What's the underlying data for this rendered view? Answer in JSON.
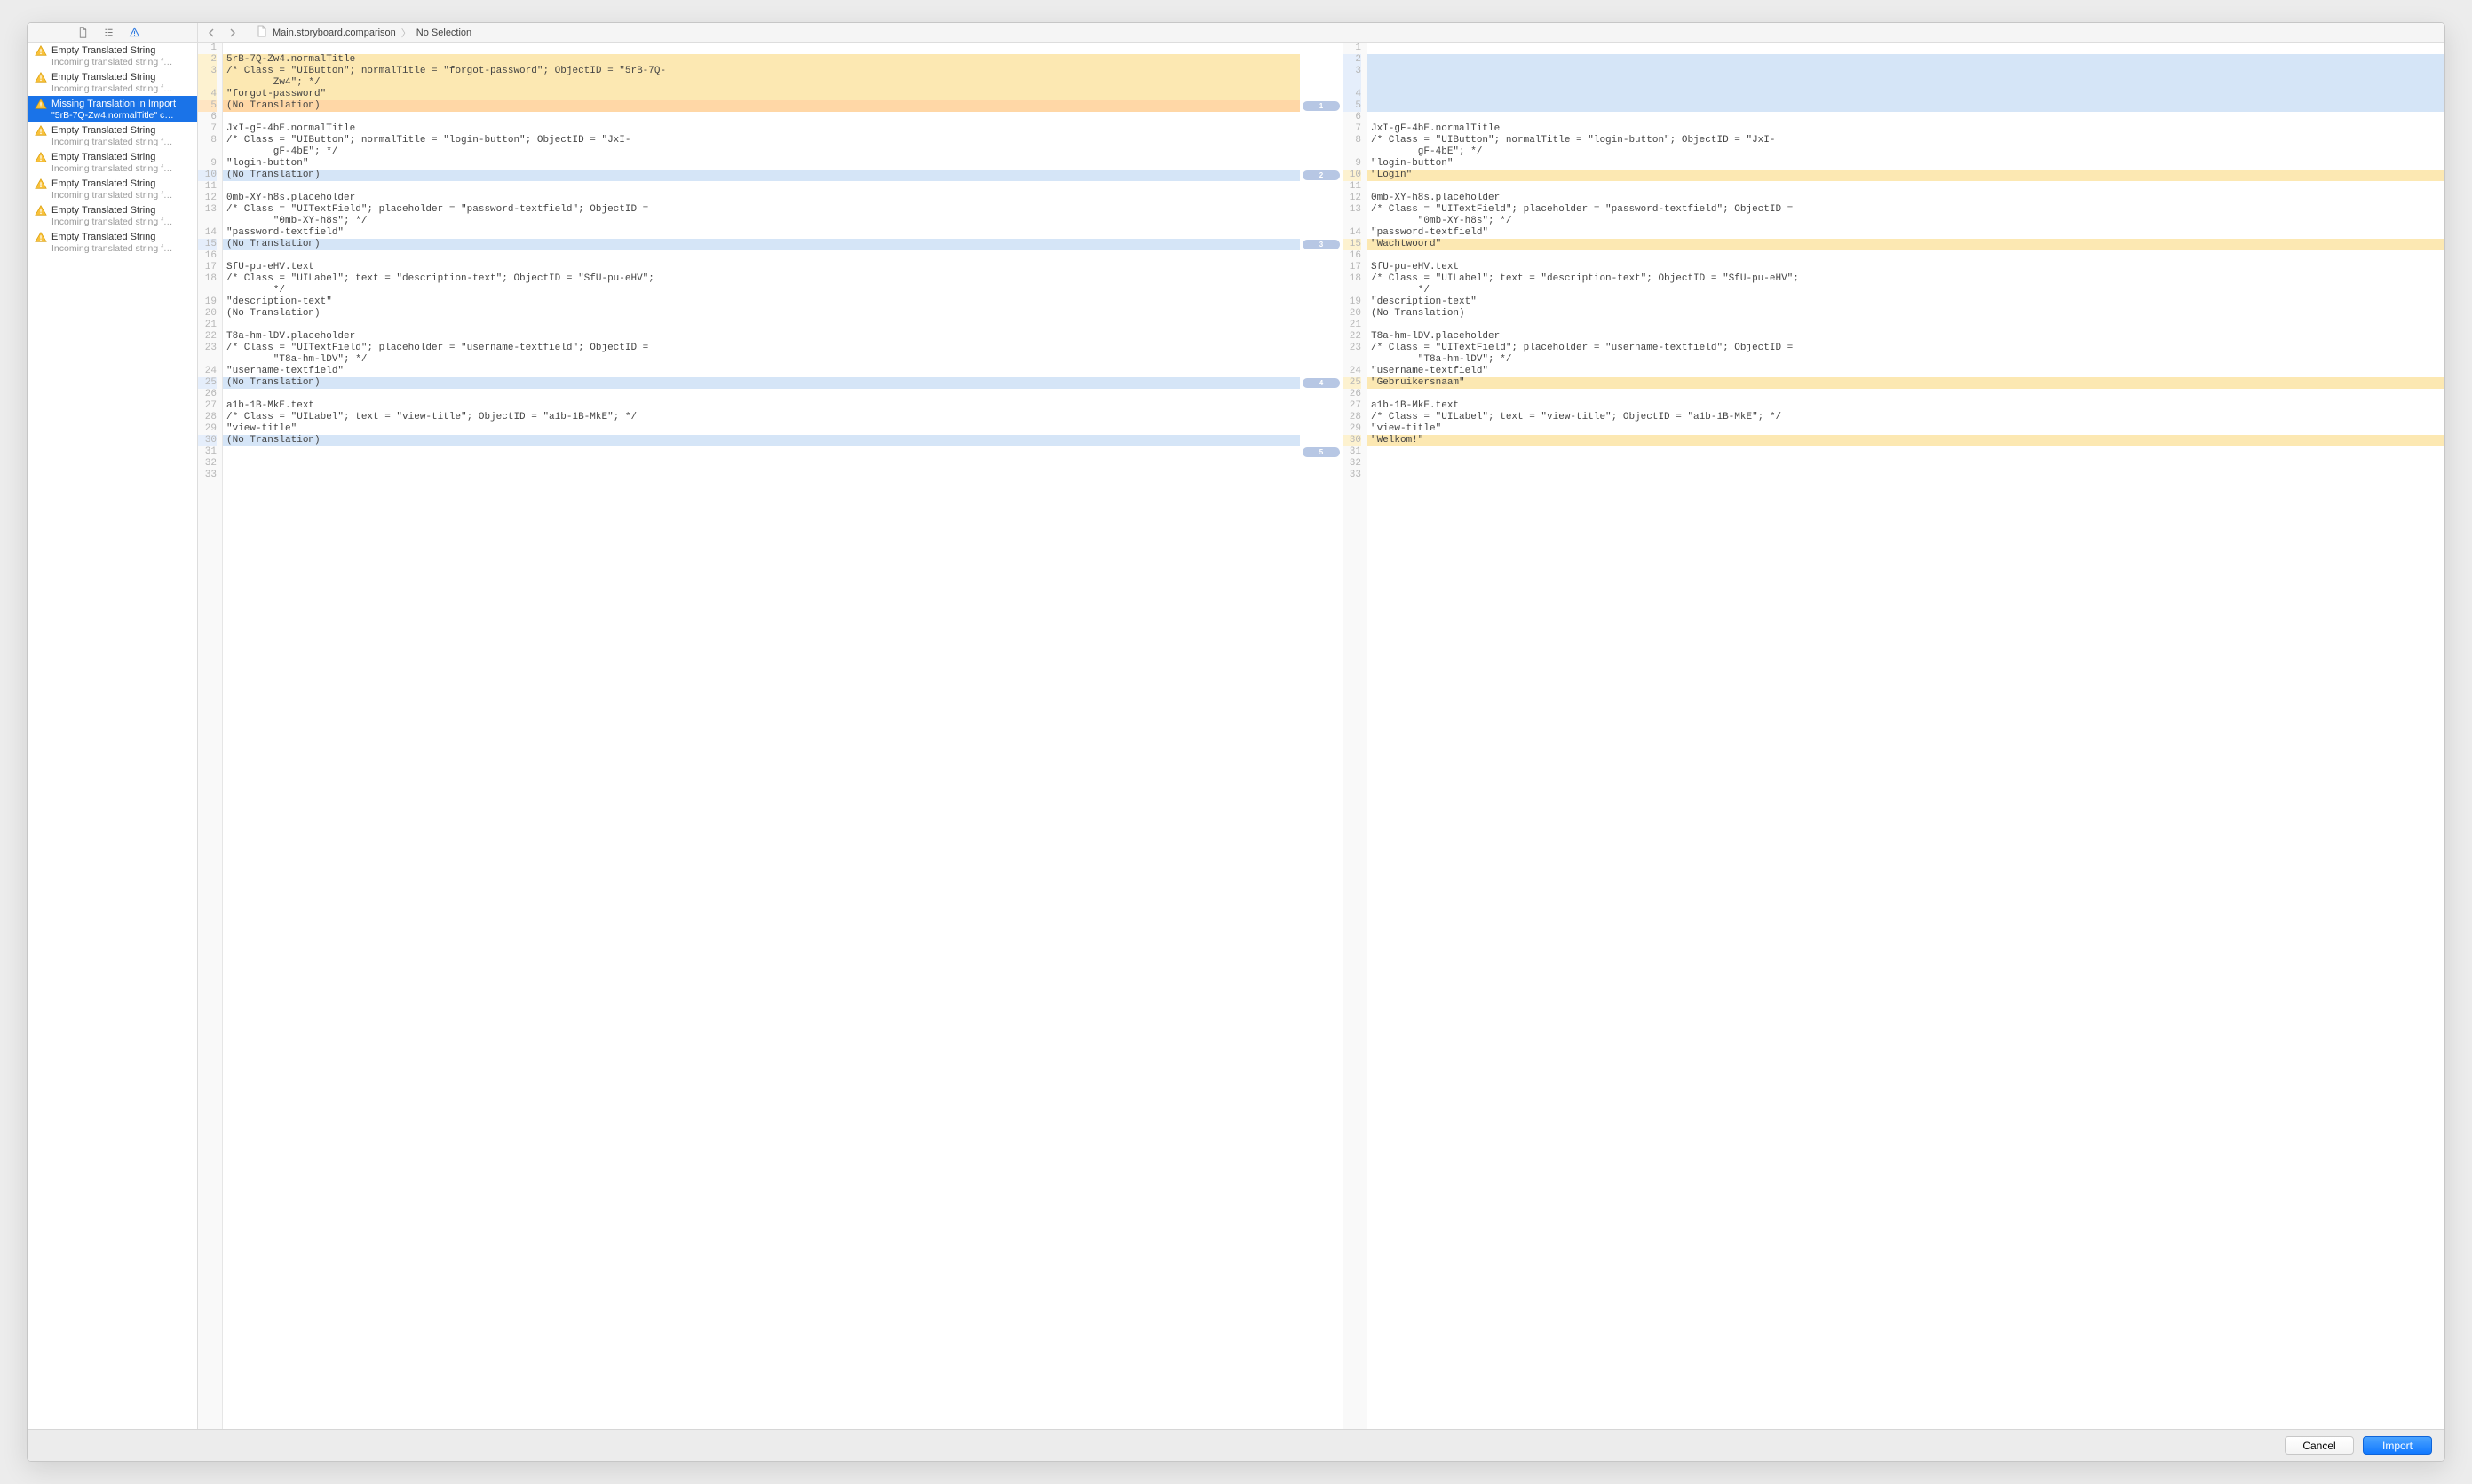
{
  "pathbar": {
    "crumb1": "Main.storyboard.comparison",
    "crumb2": "No Selection"
  },
  "sidebar": {
    "issues": [
      {
        "title": "Empty Translated String",
        "sub": "Incoming translated string f…",
        "selected": false
      },
      {
        "title": "Empty Translated String",
        "sub": "Incoming translated string f…",
        "selected": false
      },
      {
        "title": "Missing Translation in Import",
        "sub": "\"5rB-7Q-Zw4.normalTitle\" c…",
        "selected": true
      },
      {
        "title": "Empty Translated String",
        "sub": "Incoming translated string f…",
        "selected": false
      },
      {
        "title": "Empty Translated String",
        "sub": "Incoming translated string f…",
        "selected": false
      },
      {
        "title": "Empty Translated String",
        "sub": "Incoming translated string f…",
        "selected": false
      },
      {
        "title": "Empty Translated String",
        "sub": "Incoming translated string f…",
        "selected": false
      },
      {
        "title": "Empty Translated String",
        "sub": "Incoming translated string f…",
        "selected": false
      }
    ]
  },
  "left": {
    "lines": [
      {
        "n": 1,
        "t": "",
        "cls": ""
      },
      {
        "n": 2,
        "t": "5rB-7Q-Zw4.normalTitle",
        "cls": "hl-yellow"
      },
      {
        "n": 3,
        "t": "/* Class = \"UIButton\"; normalTitle = \"forgot-password\"; ObjectID = \"5rB-7Q-",
        "cls": "hl-yellow"
      },
      {
        "n": "",
        "t": "        Zw4\"; */",
        "cls": "hl-yellow"
      },
      {
        "n": 4,
        "t": "\"forgot-password\"",
        "cls": "hl-yellow"
      },
      {
        "n": 5,
        "t": "(No Translation)",
        "cls": "hl-orange"
      },
      {
        "n": 6,
        "t": "",
        "cls": ""
      },
      {
        "n": 7,
        "t": "JxI-gF-4bE.normalTitle",
        "cls": ""
      },
      {
        "n": 8,
        "t": "/* Class = \"UIButton\"; normalTitle = \"login-button\"; ObjectID = \"JxI-",
        "cls": ""
      },
      {
        "n": "",
        "t": "        gF-4bE\"; */",
        "cls": ""
      },
      {
        "n": 9,
        "t": "\"login-button\"",
        "cls": ""
      },
      {
        "n": 10,
        "t": "(No Translation)",
        "cls": "hl-blue"
      },
      {
        "n": 11,
        "t": "",
        "cls": ""
      },
      {
        "n": 12,
        "t": "0mb-XY-h8s.placeholder",
        "cls": ""
      },
      {
        "n": 13,
        "t": "/* Class = \"UITextField\"; placeholder = \"password-textfield\"; ObjectID =",
        "cls": ""
      },
      {
        "n": "",
        "t": "        \"0mb-XY-h8s\"; */",
        "cls": ""
      },
      {
        "n": 14,
        "t": "\"password-textfield\"",
        "cls": ""
      },
      {
        "n": 15,
        "t": "(No Translation)",
        "cls": "hl-blue"
      },
      {
        "n": 16,
        "t": "",
        "cls": ""
      },
      {
        "n": 17,
        "t": "SfU-pu-eHV.text",
        "cls": ""
      },
      {
        "n": 18,
        "t": "/* Class = \"UILabel\"; text = \"description-text\"; ObjectID = \"SfU-pu-eHV\";",
        "cls": ""
      },
      {
        "n": "",
        "t": "        */",
        "cls": ""
      },
      {
        "n": 19,
        "t": "\"description-text\"",
        "cls": ""
      },
      {
        "n": 20,
        "t": "(No Translation)",
        "cls": ""
      },
      {
        "n": 21,
        "t": "",
        "cls": ""
      },
      {
        "n": 22,
        "t": "T8a-hm-lDV.placeholder",
        "cls": ""
      },
      {
        "n": 23,
        "t": "/* Class = \"UITextField\"; placeholder = \"username-textfield\"; ObjectID =",
        "cls": ""
      },
      {
        "n": "",
        "t": "        \"T8a-hm-lDV\"; */",
        "cls": ""
      },
      {
        "n": 24,
        "t": "\"username-textfield\"",
        "cls": ""
      },
      {
        "n": 25,
        "t": "(No Translation)",
        "cls": "hl-blue"
      },
      {
        "n": 26,
        "t": "",
        "cls": ""
      },
      {
        "n": 27,
        "t": "a1b-1B-MkE.text",
        "cls": ""
      },
      {
        "n": 28,
        "t": "/* Class = \"UILabel\"; text = \"view-title\"; ObjectID = \"a1b-1B-MkE\"; */",
        "cls": ""
      },
      {
        "n": 29,
        "t": "\"view-title\"",
        "cls": ""
      },
      {
        "n": 30,
        "t": "(No Translation)",
        "cls": "hl-blue"
      },
      {
        "n": 31,
        "t": "",
        "cls": ""
      },
      {
        "n": 32,
        "t": "",
        "cls": ""
      },
      {
        "n": 33,
        "t": "",
        "cls": ""
      }
    ]
  },
  "right": {
    "lines": [
      {
        "n": 1,
        "t": "",
        "cls": ""
      },
      {
        "n": 2,
        "t": "",
        "cls": "hl-blue"
      },
      {
        "n": 3,
        "t": "",
        "cls": "hl-blue"
      },
      {
        "n": "",
        "t": "",
        "cls": "hl-blue"
      },
      {
        "n": 4,
        "t": "",
        "cls": "hl-blue"
      },
      {
        "n": 5,
        "t": "",
        "cls": "hl-blue"
      },
      {
        "n": 6,
        "t": "",
        "cls": ""
      },
      {
        "n": 7,
        "t": "JxI-gF-4bE.normalTitle",
        "cls": ""
      },
      {
        "n": 8,
        "t": "/* Class = \"UIButton\"; normalTitle = \"login-button\"; ObjectID = \"JxI-",
        "cls": ""
      },
      {
        "n": "",
        "t": "        gF-4bE\"; */",
        "cls": ""
      },
      {
        "n": 9,
        "t": "\"login-button\"",
        "cls": ""
      },
      {
        "n": 10,
        "t": "\"Login\"",
        "cls": "hl-yellow"
      },
      {
        "n": 11,
        "t": "",
        "cls": ""
      },
      {
        "n": 12,
        "t": "0mb-XY-h8s.placeholder",
        "cls": ""
      },
      {
        "n": 13,
        "t": "/* Class = \"UITextField\"; placeholder = \"password-textfield\"; ObjectID =",
        "cls": ""
      },
      {
        "n": "",
        "t": "        \"0mb-XY-h8s\"; */",
        "cls": ""
      },
      {
        "n": 14,
        "t": "\"password-textfield\"",
        "cls": ""
      },
      {
        "n": 15,
        "t": "\"Wachtwoord\"",
        "cls": "hl-yellow"
      },
      {
        "n": 16,
        "t": "",
        "cls": ""
      },
      {
        "n": 17,
        "t": "SfU-pu-eHV.text",
        "cls": ""
      },
      {
        "n": 18,
        "t": "/* Class = \"UILabel\"; text = \"description-text\"; ObjectID = \"SfU-pu-eHV\";",
        "cls": ""
      },
      {
        "n": "",
        "t": "        */",
        "cls": ""
      },
      {
        "n": 19,
        "t": "\"description-text\"",
        "cls": ""
      },
      {
        "n": 20,
        "t": "(No Translation)",
        "cls": ""
      },
      {
        "n": 21,
        "t": "",
        "cls": ""
      },
      {
        "n": 22,
        "t": "T8a-hm-lDV.placeholder",
        "cls": ""
      },
      {
        "n": 23,
        "t": "/* Class = \"UITextField\"; placeholder = \"username-textfield\"; ObjectID =",
        "cls": ""
      },
      {
        "n": "",
        "t": "        \"T8a-hm-lDV\"; */",
        "cls": ""
      },
      {
        "n": 24,
        "t": "\"username-textfield\"",
        "cls": ""
      },
      {
        "n": 25,
        "t": "\"Gebruikersnaam\"",
        "cls": "hl-yellow"
      },
      {
        "n": 26,
        "t": "",
        "cls": ""
      },
      {
        "n": 27,
        "t": "a1b-1B-MkE.text",
        "cls": ""
      },
      {
        "n": 28,
        "t": "/* Class = \"UILabel\"; text = \"view-title\"; ObjectID = \"a1b-1B-MkE\"; */",
        "cls": ""
      },
      {
        "n": 29,
        "t": "\"view-title\"",
        "cls": ""
      },
      {
        "n": 30,
        "t": "\"Welkom!\"",
        "cls": "hl-yellow"
      },
      {
        "n": 31,
        "t": "",
        "cls": ""
      },
      {
        "n": 32,
        "t": "",
        "cls": ""
      },
      {
        "n": 33,
        "t": "",
        "cls": ""
      }
    ]
  },
  "pills": [
    {
      "label": "1",
      "row": 5
    },
    {
      "label": "2",
      "row": 11
    },
    {
      "label": "3",
      "row": 17
    },
    {
      "label": "4",
      "row": 29
    },
    {
      "label": "5",
      "row": 35
    }
  ],
  "footer": {
    "cancel": "Cancel",
    "import": "Import"
  }
}
